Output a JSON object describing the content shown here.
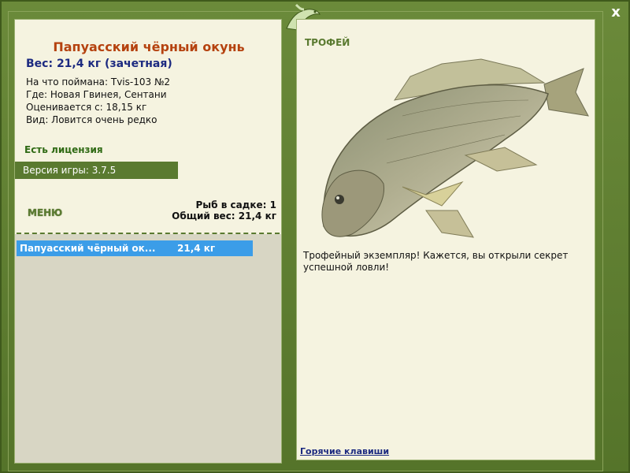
{
  "close_label": "x",
  "fish": {
    "title": "Папуасский чёрный окунь",
    "weight": "Вес: 21,4 кг (зачетная)",
    "info": [
      "На что поймана: Tvis-103 №2",
      "Где: Новая Гвинея, Сентани",
      "Оценивается с: 18,15 кг",
      "Вид: Ловится очень редко"
    ]
  },
  "license": "Есть лицензия",
  "version": "Версия игры: 3.7.5",
  "menu_label": "МЕНЮ",
  "stats": {
    "fish_count": "Рыб в садке: 1",
    "total_weight": "Общий вес: 21,4 кг"
  },
  "catch_list": [
    {
      "name": "Папуасский чёрный ок...",
      "weight": "21,4 кг"
    }
  ],
  "trophy_label": "ТРОФЕЙ",
  "description": "Трофейный экземпляр! Кажется, вы открыли секрет успешной ловли!",
  "hotkeys_label": "Горячие клавиши",
  "colors": {
    "frame": "#5a7a30",
    "panel": "#f5f3e0",
    "title": "#b5420f",
    "weight": "#1c2a80",
    "selected": "#3b9de8"
  }
}
